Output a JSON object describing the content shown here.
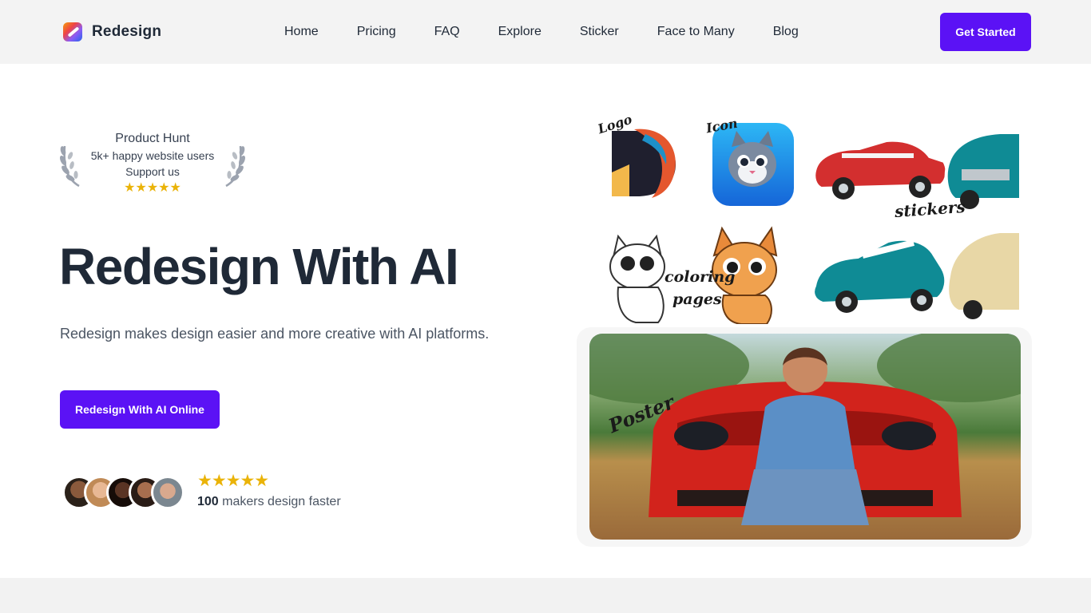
{
  "nav": {
    "brand": "Redesign",
    "links": [
      "Home",
      "Pricing",
      "FAQ",
      "Explore",
      "Sticker",
      "Face to Many",
      "Blog"
    ],
    "cta": "Get Started"
  },
  "badge": {
    "title": "Product Hunt",
    "line1": "5k+ happy website users",
    "line2": "Support us",
    "stars": "★★★★★"
  },
  "hero": {
    "title": "Redesign With AI",
    "subtitle": "Redesign makes design easier and more creative with AI platforms.",
    "cta": "Redesign With AI Online"
  },
  "social": {
    "stars": "★★★★★",
    "count": "100",
    "text": " makers design faster"
  },
  "showcase": {
    "labels": {
      "logo": "Logo",
      "icon": "Icon",
      "stickers": "stickers",
      "coloring": "coloring",
      "pages": "pages",
      "poster": "Poster"
    },
    "logo_letter": "D"
  },
  "colors": {
    "accent": "#5b12f5",
    "star": "#eab308",
    "nav_bg": "#f3f3f3",
    "heading": "#1f2937"
  }
}
